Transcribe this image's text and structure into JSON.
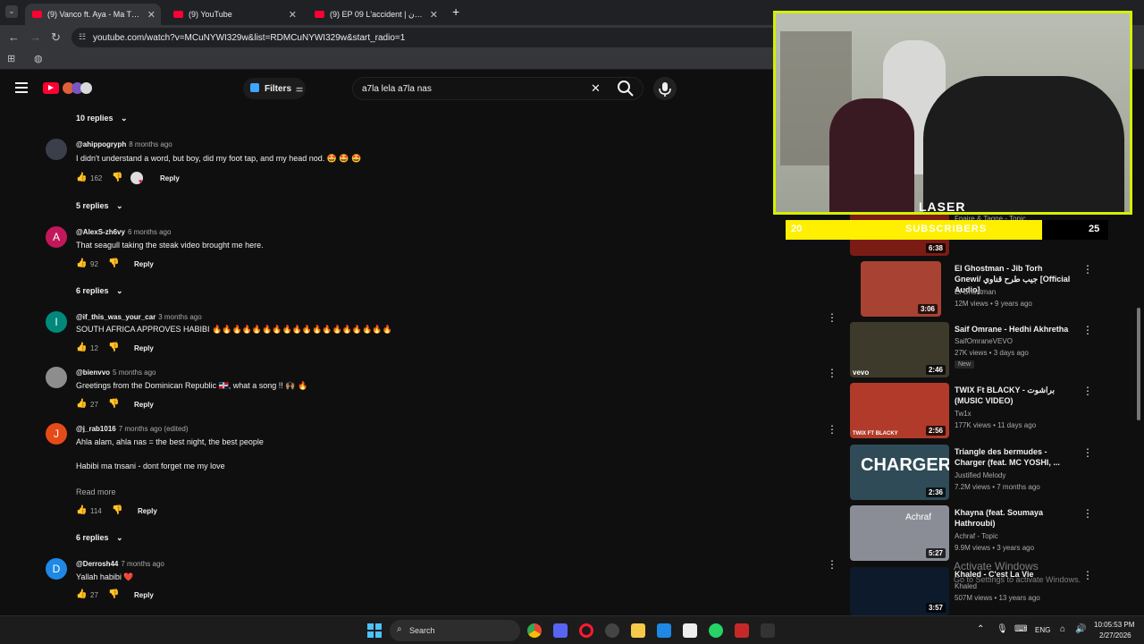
{
  "browser": {
    "tabs": [
      {
        "title": "(9) Vanco ft. Aya - Ma Tnsani (Y"
      },
      {
        "title": "(9) YouTube"
      },
      {
        "title": "(9) EP 09 L'accident | الأكسيدون"
      }
    ],
    "new_tab": "+",
    "url": "youtube.com/watch?v=MCuNYWI329w&list=RDMCuNYWI329w&start_radio=1"
  },
  "youtube": {
    "filters_label": "Filters",
    "search_value": "a7la lela a7la nas"
  },
  "comments": [
    {
      "type": "replies",
      "label": "10 replies"
    },
    {
      "type": "comment",
      "handle": "@ahippogryph",
      "time": "8 months ago",
      "text": "I didn't understand a word, but boy, did my foot tap, and my head nod. 🤩 🤩 🤩",
      "likes": "162",
      "reply": "Reply",
      "avatar_letter": "",
      "avatar_color": "#3a3f4b"
    },
    {
      "type": "replies",
      "label": "5 replies"
    },
    {
      "type": "comment",
      "handle": "@AlexS-zh6vy",
      "time": "6 months ago",
      "text": "That seagull taking the steak video brought me here.",
      "likes": "92",
      "reply": "Reply",
      "avatar_letter": "A",
      "avatar_color": "#c2185b"
    },
    {
      "type": "replies",
      "label": "6 replies"
    },
    {
      "type": "comment",
      "handle": "@if_this_was_your_car",
      "time": "3 months ago",
      "text": "SOUTH AFRICA APPROVES HABIBI 🔥🔥🔥🔥🔥🔥🔥🔥🔥🔥🔥🔥🔥🔥🔥🔥🔥🔥",
      "likes": "12",
      "reply": "Reply",
      "avatar_letter": "I",
      "avatar_color": "#00897b"
    },
    {
      "type": "comment",
      "handle": "@bienvvo",
      "time": "5 months ago",
      "text": "Greetings from the Dominican Republic 🇩🇴, what a song !! 🙌🏽 🔥",
      "likes": "27",
      "reply": "Reply",
      "avatar_letter": "",
      "avatar_color": "#8d8d8d"
    },
    {
      "type": "comment",
      "handle": "@j_rab1016",
      "time": "7 months ago (edited)",
      "text": "Ahla alam, ahla nas = the best night, the best people",
      "text2": "Habibi ma tnsani - dont forget me my love",
      "read_more": "Read more",
      "likes": "114",
      "reply": "Reply",
      "avatar_letter": "J",
      "avatar_color": "#e64a19"
    },
    {
      "type": "replies",
      "label": "6 replies"
    },
    {
      "type": "comment",
      "handle": "@Derrosh44",
      "time": "7 months ago",
      "text": "Yallah habibi ❤️",
      "likes": "27",
      "reply": "Reply",
      "avatar_letter": "D",
      "avatar_color": "#1e88e5"
    }
  ],
  "stream": {
    "subs_left": "20",
    "subs_label": "SUBSCRIBERS",
    "subs_right": "25",
    "subs_progress": 0.5,
    "logo": "LASER"
  },
  "sidebar": {
    "videos": [
      {
        "title": "",
        "channel": "Fnaire & Tagne - Topic",
        "meta": "",
        "duration": "6:38",
        "thumb": "#7a1c14"
      },
      {
        "title": "El Ghostman - Jib Torh Gnewi/ جيب طرح قناوي [Official Audio]",
        "channel": "El Ghostman",
        "meta": "12M views • 9 years ago",
        "duration": "3:06",
        "thumb": "#a84232"
      },
      {
        "title": "Saif Omrane - Hedhi Akhretha",
        "channel": "SaifOmraneVEVO",
        "meta": "27K views • 3 days ago",
        "badge": "New",
        "duration": "2:46",
        "thumb": "#3d3a2c",
        "corner": "vevo"
      },
      {
        "title": "TWIX Ft BLACKY - براشوت (MUSIC VIDEO)",
        "channel": "Tw1x",
        "meta": "177K views • 11 days ago",
        "duration": "2:56",
        "thumb": "#b13a2a",
        "corner": "TWIX FT BLACKY"
      },
      {
        "title": "Triangle des bermudes - Charger (feat. MC YOSHI, ...",
        "channel": "Justified Melody",
        "meta": "7.2M views • 7 months ago",
        "duration": "2:36",
        "thumb": "#2f4b57",
        "big": "CHARGER"
      },
      {
        "title": "Khayna (feat. Soumaya Hathroubi)",
        "channel": "Achraf - Topic",
        "meta": "9.9M views • 3 years ago",
        "duration": "5:27",
        "thumb": "#8a8d96",
        "big": "Achraf"
      },
      {
        "title": "Khaled - C'est La Vie",
        "channel": "Khaled",
        "meta": "507M views • 13 years ago",
        "duration": "3:57",
        "thumb": "#0d1a2b"
      }
    ]
  },
  "watermark": {
    "line1": "Activate Windows",
    "line2": "Go to Settings to activate Windows."
  },
  "taskbar": {
    "search": "Search",
    "lang": "ENG",
    "time": "10:05:53 PM",
    "date": "2/27/2026"
  }
}
